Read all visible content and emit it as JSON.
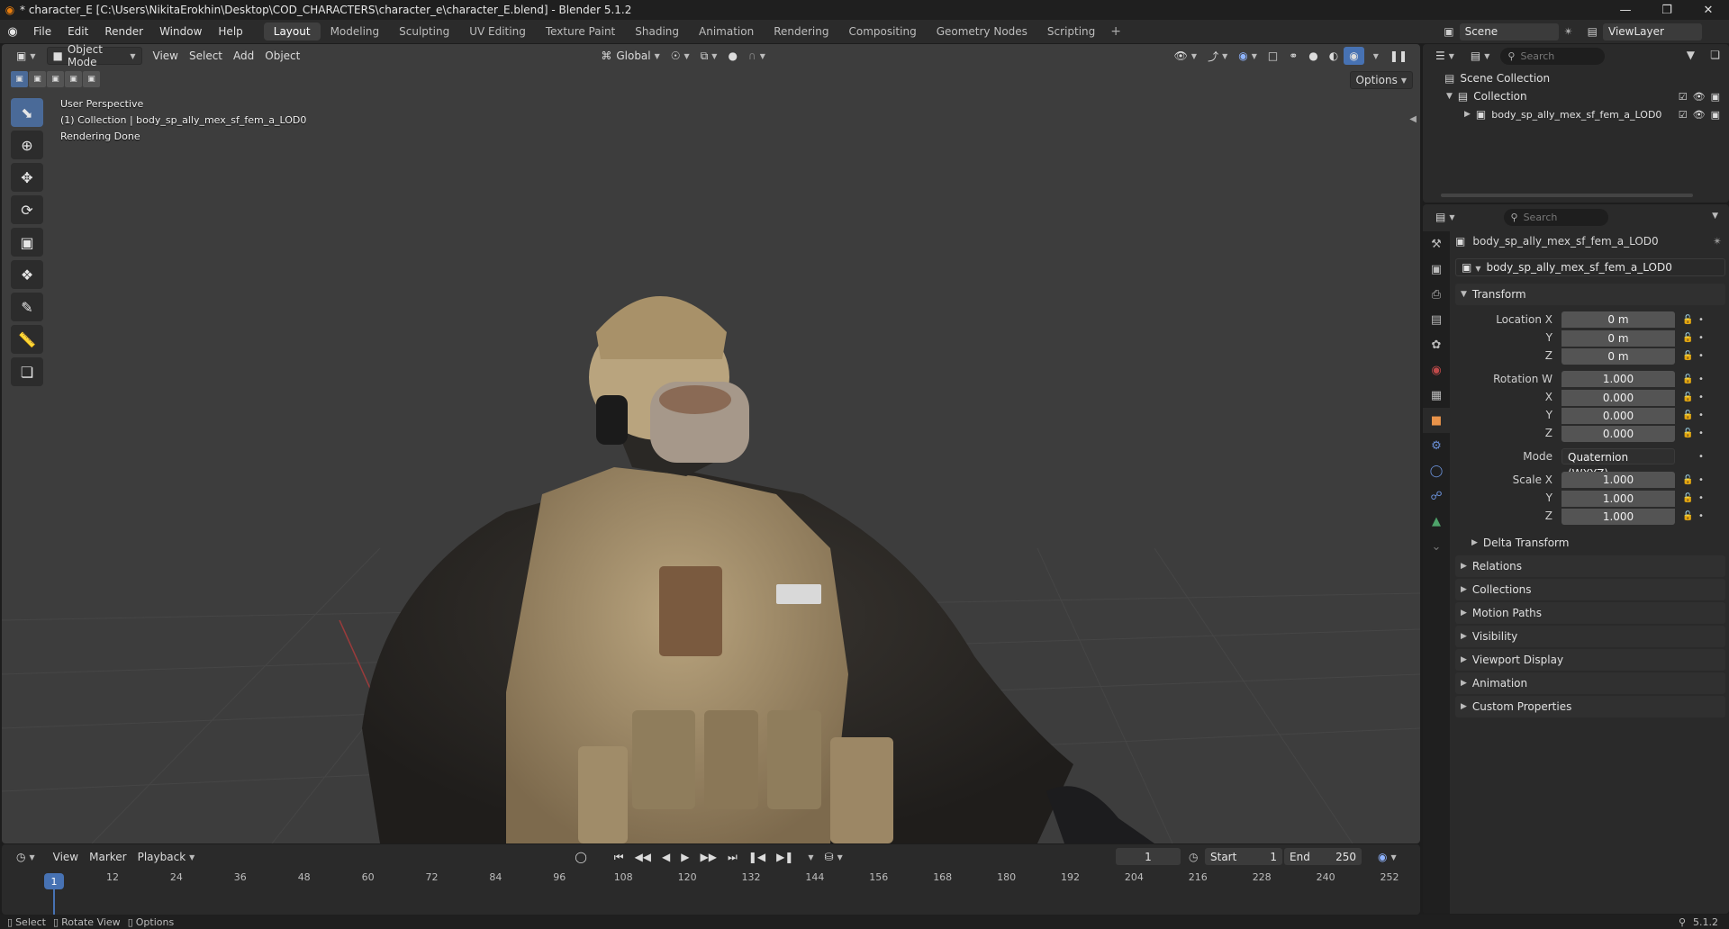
{
  "window": {
    "title": "* character_E [C:\\Users\\NikitaErokhin\\Desktop\\COD_CHARACTERS\\character_e\\character_E.blend] - Blender 5.1.2"
  },
  "menubar": {
    "menus": [
      "File",
      "Edit",
      "Render",
      "Window",
      "Help"
    ],
    "workspaces": [
      "Layout",
      "Modeling",
      "Sculpting",
      "UV Editing",
      "Texture Paint",
      "Shading",
      "Animation",
      "Rendering",
      "Compositing",
      "Geometry Nodes",
      "Scripting"
    ],
    "active_workspace": "Layout",
    "scene": "Scene",
    "view_layer": "ViewLayer"
  },
  "viewport": {
    "mode": "Object Mode",
    "menus": [
      "View",
      "Select",
      "Add",
      "Object"
    ],
    "transform_orientation": "Global",
    "options_label": "Options",
    "overlay_lines": [
      "User Perspective",
      "(1) Collection | body_sp_ally_mex_sf_fem_a_LOD0",
      "Rendering Done"
    ],
    "tools": [
      "select-box",
      "cursor",
      "move",
      "rotate",
      "scale",
      "transform",
      "annotate",
      "measure",
      "add-cube"
    ],
    "active_tool": "select-box"
  },
  "timeline": {
    "menus": [
      "View",
      "Marker",
      "Playback"
    ],
    "current_frame": "1",
    "start_label": "Start",
    "start": "1",
    "end_label": "End",
    "end": "250",
    "ticks": [
      "12",
      "24",
      "36",
      "48",
      "60",
      "72",
      "84",
      "96",
      "108",
      "120",
      "132",
      "144",
      "156",
      "168",
      "180",
      "192",
      "204",
      "216",
      "228",
      "240",
      "252"
    ],
    "playhead": "1"
  },
  "statusbar": {
    "items": [
      "Select",
      "Rotate View",
      "Options"
    ],
    "version": "5.1.2"
  },
  "outliner": {
    "search_placeholder": "Search",
    "scene_collection": "Scene Collection",
    "collection": "Collection",
    "object": "body_sp_ally_mex_sf_fem_a_LOD0"
  },
  "properties": {
    "search_placeholder": "Search",
    "object_name": "body_sp_ally_mex_sf_fem_a_LOD0",
    "datablock_name": "body_sp_ally_mex_sf_fem_a_LOD0",
    "transform_label": "Transform",
    "location": {
      "label": "Location X",
      "x": "0 m",
      "y": "0 m",
      "z": "0 m"
    },
    "rotation": {
      "label": "Rotation W",
      "w": "1.000",
      "x": "0.000",
      "y": "0.000",
      "z": "0.000"
    },
    "mode_label": "Mode",
    "mode_value": "Quaternion (WXYZ)",
    "scale": {
      "label": "Scale X",
      "x": "1.000",
      "y": "1.000",
      "z": "1.000"
    },
    "axis_labels": {
      "y": "Y",
      "z": "Z",
      "x": "X"
    },
    "delta_transform": "Delta Transform",
    "panels": [
      "Relations",
      "Collections",
      "Motion Paths",
      "Visibility",
      "Viewport Display",
      "Animation",
      "Custom Properties"
    ]
  },
  "colors": {
    "accent": "#4772b3",
    "object_orange": "#e8934a",
    "viewport_bg": "#3d3d3d"
  }
}
